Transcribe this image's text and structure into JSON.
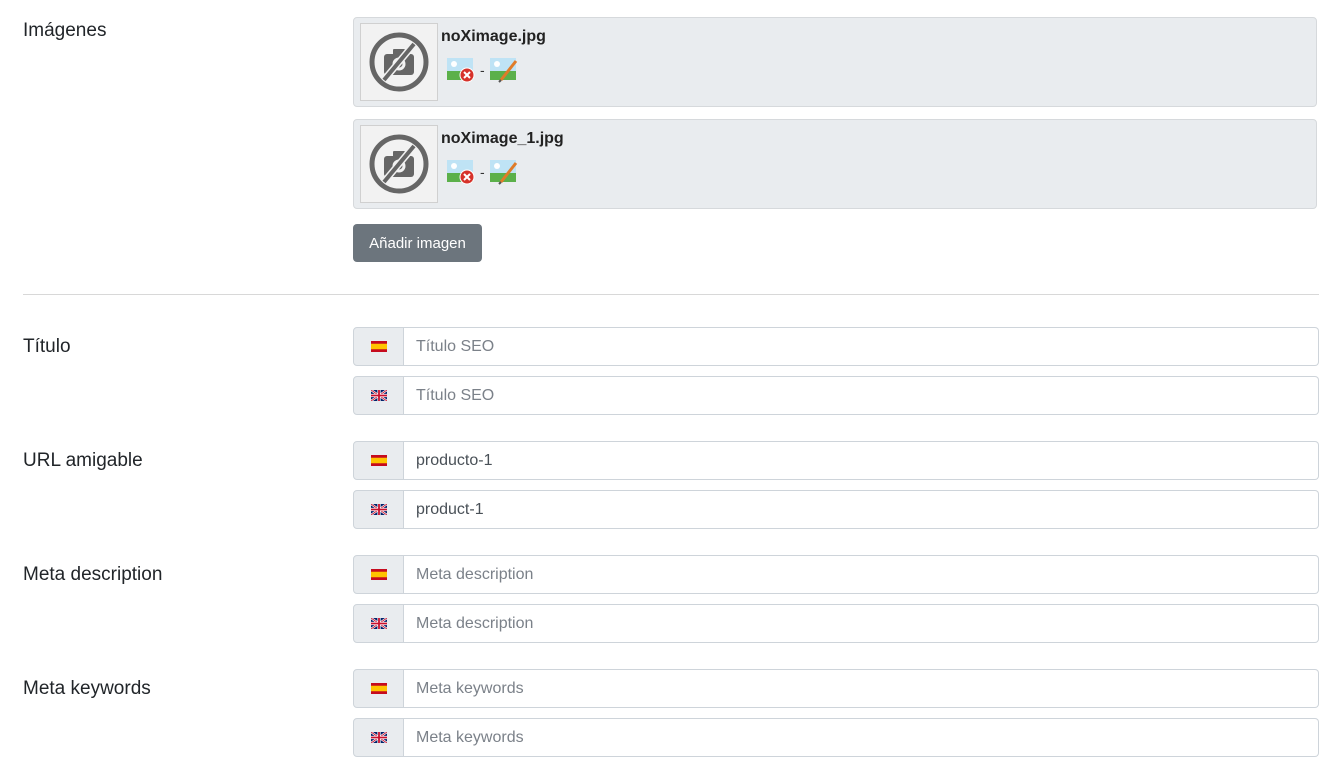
{
  "images": {
    "label": "Imágenes",
    "items": [
      {
        "filename": "noXimage.jpg",
        "separator": "-"
      },
      {
        "filename": "noXimage_1.jpg",
        "separator": "-"
      }
    ],
    "add_button": "Añadir imagen"
  },
  "fields": [
    {
      "label": "Título",
      "inputs": [
        {
          "lang": "es",
          "flag_icon": "spain-flag-icon",
          "value": "",
          "placeholder": "Título SEO"
        },
        {
          "lang": "en",
          "flag_icon": "uk-flag-icon",
          "value": "",
          "placeholder": "Título SEO"
        }
      ]
    },
    {
      "label": "URL amigable",
      "inputs": [
        {
          "lang": "es",
          "flag_icon": "spain-flag-icon",
          "value": "producto-1",
          "placeholder": ""
        },
        {
          "lang": "en",
          "flag_icon": "uk-flag-icon",
          "value": "product-1",
          "placeholder": ""
        }
      ]
    },
    {
      "label": "Meta description",
      "inputs": [
        {
          "lang": "es",
          "flag_icon": "spain-flag-icon",
          "value": "",
          "placeholder": "Meta description"
        },
        {
          "lang": "en",
          "flag_icon": "uk-flag-icon",
          "value": "",
          "placeholder": "Meta description"
        }
      ]
    },
    {
      "label": "Meta keywords",
      "inputs": [
        {
          "lang": "es",
          "flag_icon": "spain-flag-icon",
          "value": "",
          "placeholder": "Meta keywords"
        },
        {
          "lang": "en",
          "flag_icon": "uk-flag-icon",
          "value": "",
          "placeholder": "Meta keywords"
        }
      ]
    }
  ],
  "colors": {
    "button_bg": "#6c757d",
    "card_bg": "#e9ecef",
    "input_border": "#ced4da"
  }
}
